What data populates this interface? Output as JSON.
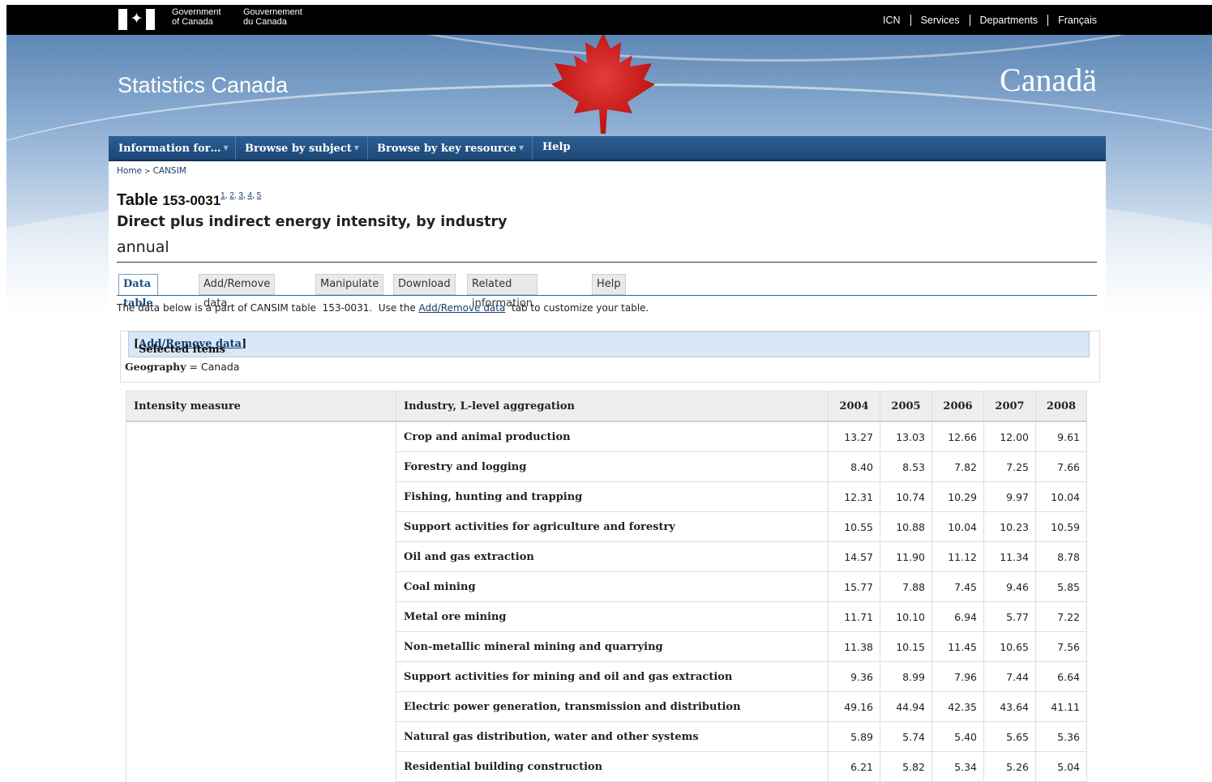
{
  "fip": {
    "gov_en_line1": "Government",
    "gov_en_line2": "of Canada",
    "gov_fr_line1": "Gouvernement",
    "gov_fr_line2": "du Canada",
    "links": [
      "ICN",
      "Services",
      "Departments",
      "Français"
    ]
  },
  "banner": {
    "site_title": "Statistics Canada",
    "wordmark": "Canadä"
  },
  "nav": {
    "items": [
      {
        "label": "Information for…",
        "has_caret": true
      },
      {
        "label": "Browse by subject",
        "has_caret": true
      },
      {
        "label": "Browse by key resource",
        "has_caret": true
      },
      {
        "label": "Help",
        "has_caret": false
      }
    ]
  },
  "breadcrumb": {
    "home": "Home",
    "current": "CANSIM"
  },
  "header": {
    "table_label": "Table",
    "table_number": "153-0031",
    "footnotes": [
      "1",
      "2",
      "3",
      "4",
      "5"
    ],
    "title": "Direct plus indirect energy intensity, by industry",
    "frequency": "annual"
  },
  "tabs": [
    {
      "label": "Data table",
      "active": true
    },
    {
      "label": "Add/Remove data",
      "active": false
    },
    {
      "label": "Manipulate",
      "active": false
    },
    {
      "label": "Download",
      "active": false
    },
    {
      "label": "Related information",
      "active": false
    },
    {
      "label": "Help",
      "active": false
    }
  ],
  "intro": {
    "before": "The data below is a part of CANSIM table  153-0031.  Use the ",
    "link": "Add/Remove data",
    "after": "  tab to customize your table."
  },
  "selected": {
    "heading": "Selected items",
    "link": "Add/Remove data",
    "geo_label": "Geography",
    "geo_value": "= Canada"
  },
  "table": {
    "headers": {
      "measure": "Intensity measure",
      "industry": "Industry, L-level aggregation",
      "years": [
        "2004",
        "2005",
        "2006",
        "2007",
        "2008"
      ]
    },
    "rows": [
      {
        "industry": "Crop and animal production",
        "values": [
          "13.27",
          "13.03",
          "12.66",
          "12.00",
          "9.61"
        ]
      },
      {
        "industry": "Forestry and logging",
        "values": [
          "8.40",
          "8.53",
          "7.82",
          "7.25",
          "7.66"
        ]
      },
      {
        "industry": "Fishing, hunting and trapping",
        "values": [
          "12.31",
          "10.74",
          "10.29",
          "9.97",
          "10.04"
        ]
      },
      {
        "industry": "Support activities for agriculture and forestry",
        "values": [
          "10.55",
          "10.88",
          "10.04",
          "10.23",
          "10.59"
        ]
      },
      {
        "industry": "Oil and gas extraction",
        "values": [
          "14.57",
          "11.90",
          "11.12",
          "11.34",
          "8.78"
        ]
      },
      {
        "industry": "Coal mining",
        "values": [
          "15.77",
          "7.88",
          "7.45",
          "9.46",
          "5.85"
        ]
      },
      {
        "industry": "Metal ore mining",
        "values": [
          "11.71",
          "10.10",
          "6.94",
          "5.77",
          "7.22"
        ]
      },
      {
        "industry": "Non-metallic mineral mining and quarrying",
        "values": [
          "11.38",
          "10.15",
          "11.45",
          "10.65",
          "7.56"
        ]
      },
      {
        "industry": "Support activities for mining and oil and gas extraction",
        "values": [
          "9.36",
          "8.99",
          "7.96",
          "7.44",
          "6.64"
        ]
      },
      {
        "industry": "Electric power generation, transmission and distribution",
        "values": [
          "49.16",
          "44.94",
          "42.35",
          "43.64",
          "41.11"
        ]
      },
      {
        "industry": "Natural gas distribution, water and other systems",
        "values": [
          "5.89",
          "5.74",
          "5.40",
          "5.65",
          "5.36"
        ]
      },
      {
        "industry": "Residential building construction",
        "values": [
          "6.21",
          "5.82",
          "5.34",
          "5.26",
          "5.04"
        ]
      }
    ]
  },
  "colors": {
    "nav_bg": "#1f4e7d",
    "link": "#1a3d6d",
    "flag_red": "#cc0000"
  }
}
